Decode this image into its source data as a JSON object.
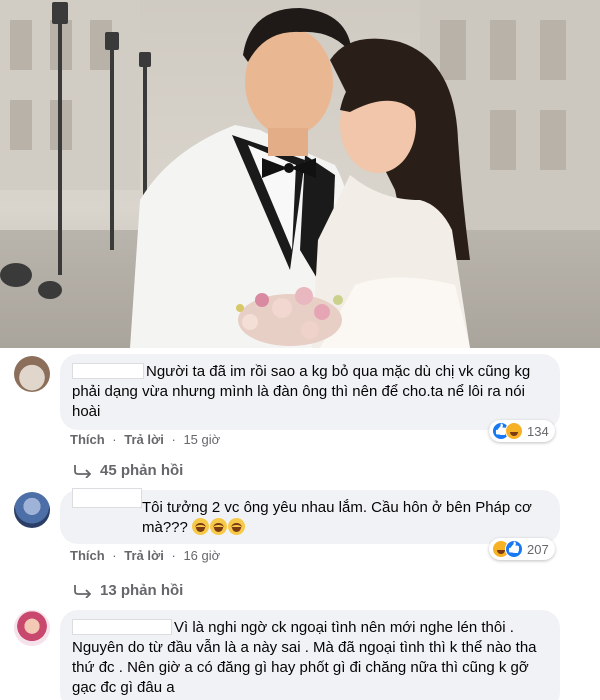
{
  "comments": [
    {
      "text": "Người ta đã im rồi sao a kg bỏ qua mặc dù chị vk cũng kg phải dạng vừa nhưng mình là đàn ông thì nên để cho.ta nể lôi ra nói hoài",
      "like_label": "Thích",
      "reply_label": "Trả lời",
      "time": "15 giờ",
      "reaction_count": "134",
      "replies_label": "45 phản hồi"
    },
    {
      "text": "Tôi tưởng 2 vc ông yêu nhau lắm. Cầu hôn ở bên Pháp cơ mà???",
      "like_label": "Thích",
      "reply_label": "Trả lời",
      "time": "16 giờ",
      "reaction_count": "207",
      "replies_label": "13 phản hồi"
    },
    {
      "text": "Vì là nghi ngờ ck ngoại tình nên mới nghe lén thôi . Nguyên do từ đầu vẫn là a này sai . Mà đã ngoại tình thì k thể nào tha thứ đc . Nên giờ a có đăng gì hay phốt gì đi chăng nữa thì cũng k gỡ gạc đc gì đâu a"
    }
  ],
  "icons": {
    "reaction_like": "like-icon",
    "reaction_haha": "haha-icon",
    "reply_arrow": "reply-arrow-icon"
  },
  "colors": {
    "bubble_bg": "#f0f2f5",
    "meta_text": "#65676b",
    "like_blue": "#1877f2",
    "haha_yellow": "#f7b125"
  }
}
